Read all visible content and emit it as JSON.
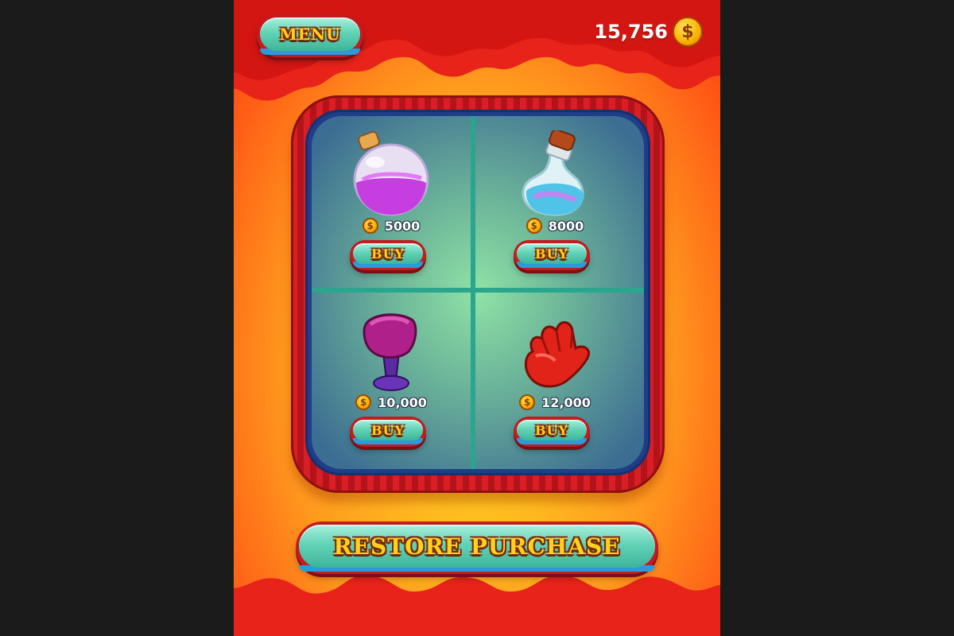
{
  "header": {
    "menu_label": "MENU",
    "coin_balance": "15,756",
    "coin_symbol": "$"
  },
  "shop": {
    "items": [
      {
        "icon": "pink-potion-round-icon",
        "price": "5000",
        "buy_label": "BUY"
      },
      {
        "icon": "blue-potion-flask-icon",
        "price": "8000",
        "buy_label": "BUY"
      },
      {
        "icon": "purple-hammer-icon",
        "price": "10,000",
        "buy_label": "BUY"
      },
      {
        "icon": "red-glove-hand-icon",
        "price": "12,000",
        "buy_label": "BUY"
      }
    ]
  },
  "footer": {
    "restore_label": "RESTORE PURCHASE"
  },
  "colors": {
    "background_outer": "#1b1b1b",
    "panel_gradient_center": "#ffe23a",
    "panel_gradient_edge": "#f23a12",
    "frame_red": "#d91f25",
    "button_teal": "#63d3b6",
    "button_text_gold": "#ffd21c"
  }
}
